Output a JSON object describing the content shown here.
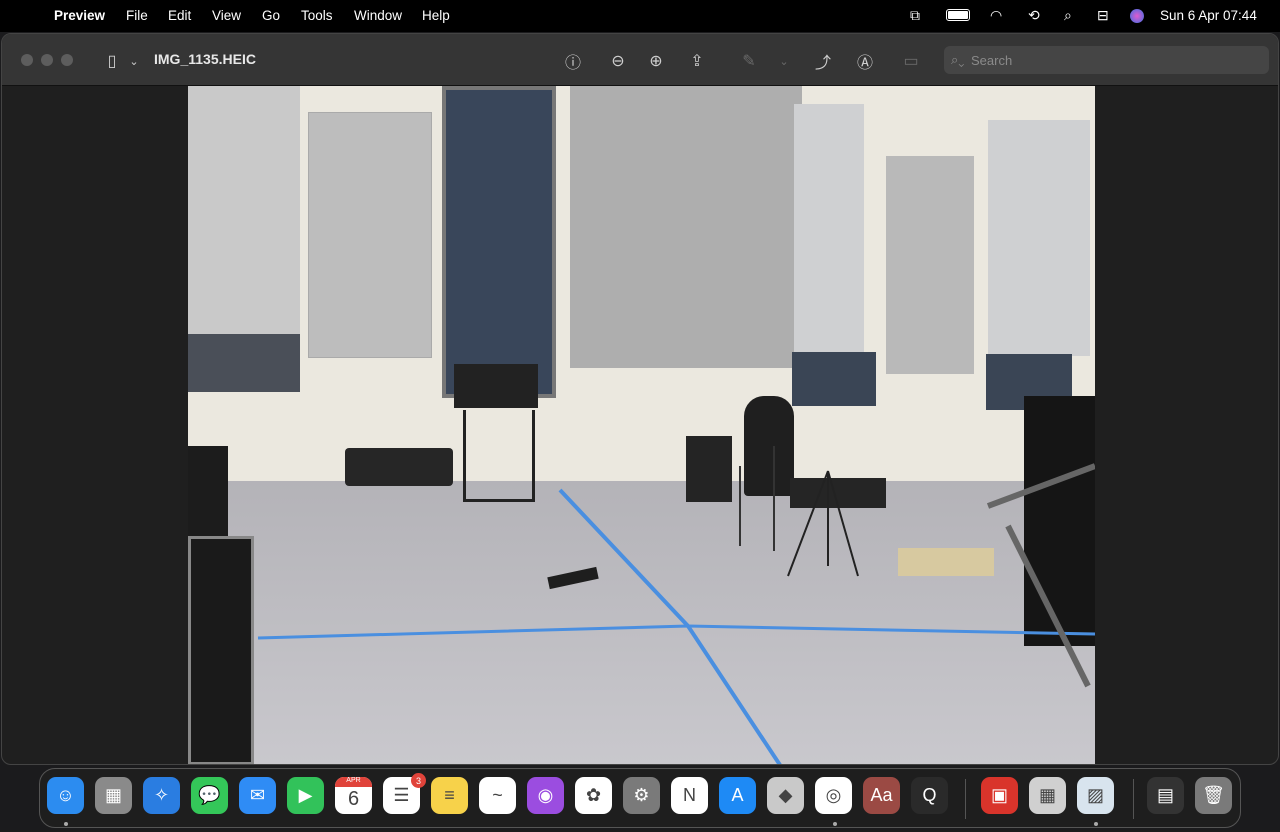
{
  "menubar": {
    "app": "Preview",
    "items": [
      "File",
      "Edit",
      "View",
      "Go",
      "Tools",
      "Window",
      "Help"
    ],
    "datetime": "Sun 6 Apr  07:44"
  },
  "window": {
    "title": "IMG_1135.HEIC",
    "search_placeholder": "Search"
  },
  "dock": {
    "apps": [
      {
        "name": "Finder",
        "color": "#2c8cf0",
        "glyph": "☺"
      },
      {
        "name": "Launchpad",
        "color": "#8a8a8a",
        "glyph": "▦"
      },
      {
        "name": "Safari",
        "color": "#2a7de1",
        "glyph": "✧"
      },
      {
        "name": "Messages",
        "color": "#34c759",
        "glyph": "💬"
      },
      {
        "name": "Mail",
        "color": "#2f8cf5",
        "glyph": "✉"
      },
      {
        "name": "FaceTime",
        "color": "#32c25a",
        "glyph": "▶"
      },
      {
        "name": "Calendar",
        "color": "#ffffff",
        "glyph": "6"
      },
      {
        "name": "Reminders",
        "color": "#ffffff",
        "glyph": "☰",
        "badge": "3"
      },
      {
        "name": "Notes",
        "color": "#f7d24a",
        "glyph": "≡"
      },
      {
        "name": "Freeform",
        "color": "#ffffff",
        "glyph": "~"
      },
      {
        "name": "Podcasts",
        "color": "#9b4de0",
        "glyph": "◉"
      },
      {
        "name": "Photos",
        "color": "#ffffff",
        "glyph": "✿"
      },
      {
        "name": "System Settings",
        "color": "#7a7a7a",
        "glyph": "⚙"
      },
      {
        "name": "News",
        "color": "#ffffff",
        "glyph": "N"
      },
      {
        "name": "App Store",
        "color": "#1e8af5",
        "glyph": "A"
      },
      {
        "name": "Roblox",
        "color": "#c9c9c9",
        "glyph": "◆"
      },
      {
        "name": "Chrome",
        "color": "#ffffff",
        "glyph": "◎"
      },
      {
        "name": "Dictionary",
        "color": "#9b4a44",
        "glyph": "Aa"
      },
      {
        "name": "QuickTime Player",
        "color": "#2a2a2a",
        "glyph": "Q"
      },
      {
        "name": "Photo Booth",
        "color": "#d9342b",
        "glyph": "▣"
      },
      {
        "name": "Calculator",
        "color": "#d0d0d0",
        "glyph": "▦"
      },
      {
        "name": "Preview",
        "color": "#d8e4ee",
        "glyph": "▨"
      },
      {
        "name": "Downloads",
        "color": "#333333",
        "glyph": "▤"
      },
      {
        "name": "Trash",
        "color": "#7a7a7a",
        "glyph": "🗑"
      }
    ],
    "calendar_month": "APR"
  }
}
